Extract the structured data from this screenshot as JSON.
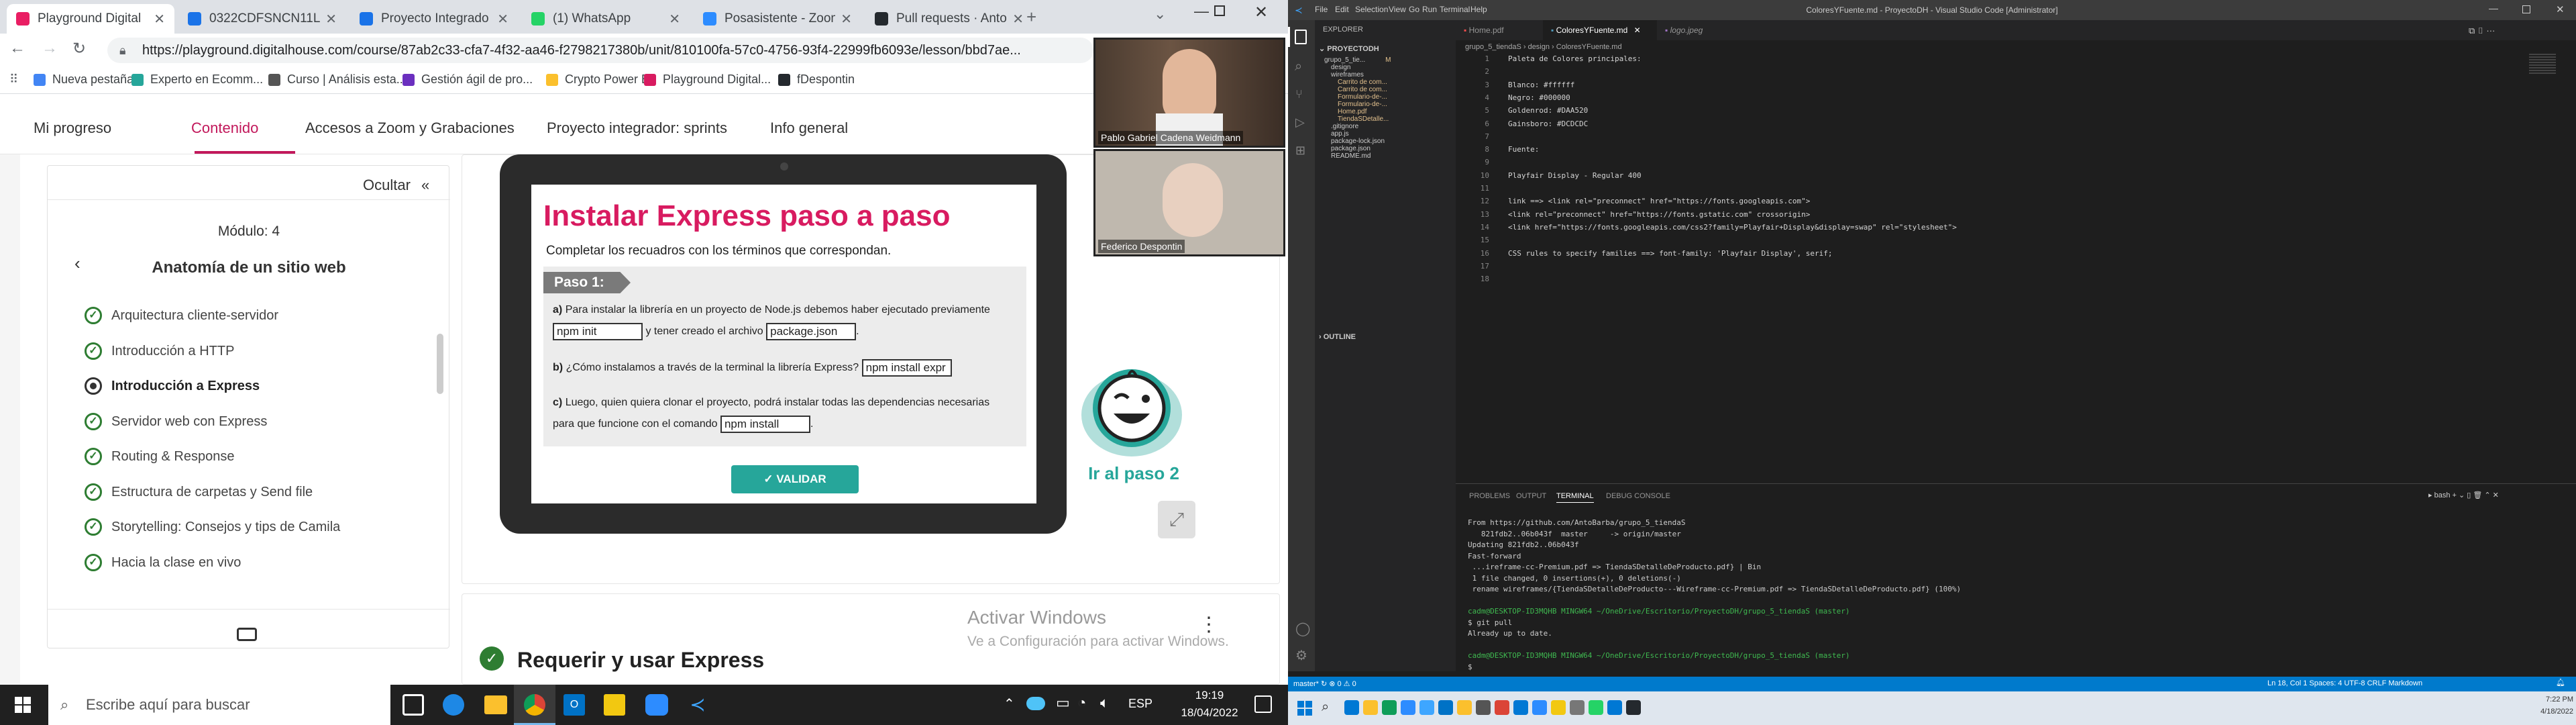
{
  "browser": {
    "tabs": [
      {
        "label": "Playground Digital",
        "color": "#e91e63",
        "active": true
      },
      {
        "label": "0322CDFSNCN11L",
        "color": "#1a73e8"
      },
      {
        "label": "Proyecto Integrado",
        "color": "#1a73e8"
      },
      {
        "label": "(1) WhatsApp",
        "color": "#25d366"
      },
      {
        "label": "Posasistente - Zoom",
        "color": "#2d8cff"
      },
      {
        "label": "Pull requests · Anto",
        "color": "#24292e"
      }
    ],
    "url": "https://playground.digitalhouse.com/course/87ab2c33-cfa7-4f32-aa46-f2798217380b/unit/810100fa-57c0-4756-93f4-22999fb6093e/lesson/bbd7ae...",
    "bookmarks": [
      "Nueva pestaña",
      "Experto en Ecomm...",
      "Curso | Análisis esta...",
      "Gestión ágil de pro...",
      "Crypto Power BI",
      "Playground Digital...",
      "fDespontin"
    ]
  },
  "nav": {
    "items": [
      "Mi progreso",
      "Contenido",
      "Accesos a Zoom y Grabaciones",
      "Proyecto integrador: sprints",
      "Info general"
    ]
  },
  "sidebar": {
    "hide_label": "Ocultar",
    "module": "Módulo: 4",
    "title": "Anatomía de un sitio web",
    "lessons": [
      "Arquitectura cliente-servidor",
      "Introducción a HTTP",
      "Introducción a Express",
      "Servidor web con Express",
      "Routing & Response",
      "Estructura de carpetas y Send file",
      "Storytelling: Consejos y tips de Camila",
      "Hacia la clase en vivo"
    ]
  },
  "slide": {
    "title": "Instalar Express paso a paso",
    "subtitle": "Completar los recuadros con los términos que correspondan.",
    "step": "Paso 1:",
    "qa_letter": "a)",
    "qa_text1": "Para instalar la librería en un proyecto de Node.js debemos haber ejecutado previamente",
    "qa_input1": "npm init",
    "qa_text2": "y tener creado el archivo",
    "qa_input2": "package.json",
    "qa_end": ".",
    "qb_letter": "b)",
    "qb_text": "¿Cómo instalamos a través de la terminal la librería Express?",
    "qb_input": "npm install expr",
    "qc_letter": "c)",
    "qc_text1": "Luego, quien quiera clonar el proyecto, podrá instalar todas las dependencias necesarias",
    "qc_text2": "para que funcione con el comando",
    "qc_input": "npm install",
    "qc_end": ".",
    "validate": "VALIDAR",
    "next_step": "Ir al paso 2"
  },
  "next_section": "Requerir y usar Express",
  "watermark": {
    "line1": "Activar Windows",
    "line2": "Ve a Configuración para activar Windows."
  },
  "zoom": {
    "p1": "Pablo Gabriel Cadena Weidmann",
    "p2": "Federico Despontin"
  },
  "taskbar": {
    "search": "Escribe aquí para buscar",
    "lang": "ESP",
    "time": "19:19",
    "date": "18/04/2022"
  },
  "vscode": {
    "title": "ColoresYFuente.md - ProyectoDH - Visual Studio Code [Administrator]",
    "menu": [
      "File",
      "Edit",
      "Selection",
      "View",
      "Go",
      "Run",
      "Terminal",
      "Help"
    ],
    "explorer_title": "EXPLORER",
    "project": "PROYECTODH",
    "tree": [
      {
        "t": "grupo_5_tie...",
        "d": 0,
        "c": "#ccc",
        "m": "M"
      },
      {
        "t": "design",
        "d": 1,
        "c": "#ccc"
      },
      {
        "t": "wireframes",
        "d": 1,
        "c": "#ccc"
      },
      {
        "t": "Carrito de com...",
        "d": 2,
        "c": "#e2c08d"
      },
      {
        "t": "Carrito de com...",
        "d": 2,
        "c": "#e2c08d"
      },
      {
        "t": "Formulario-de-...",
        "d": 2,
        "c": "#e2c08d"
      },
      {
        "t": "Formulario-de-...",
        "d": 2,
        "c": "#e2c08d"
      },
      {
        "t": "Home.pdf",
        "d": 2,
        "c": "#e2c08d"
      },
      {
        "t": "TiendaSDetalle...",
        "d": 2,
        "c": "#e2c08d"
      },
      {
        "t": ".gitignore",
        "d": 1,
        "c": "#ccc"
      },
      {
        "t": "app.js",
        "d": 1,
        "c": "#ccc"
      },
      {
        "t": "package-lock.json",
        "d": 1,
        "c": "#ccc"
      },
      {
        "t": "package.json",
        "d": 1,
        "c": "#ccc"
      },
      {
        "t": "README.md",
        "d": 1,
        "c": "#ccc"
      }
    ],
    "outline": "OUTLINE",
    "editor_tabs": [
      "Home.pdf",
      "ColoresYFuente.md",
      "logo.jpeg"
    ],
    "breadcrumb": "grupo_5_tiendaS  ›  design  ›  ColoresYFuente.md",
    "code": [
      "Paleta de Colores principales:",
      "",
      "Blanco: #ffffff",
      "Negro: #000000",
      "Goldenrod: #DAA520",
      "Gainsboro: #DCDCDC",
      "",
      "Fuente:",
      "",
      "Playfair Display - Regular 400",
      "",
      "link ==> <link rel=\"preconnect\" href=\"https://fonts.googleapis.com\">",
      "<link rel=\"preconnect\" href=\"https://fonts.gstatic.com\" crossorigin>",
      "<link href=\"https://fonts.googleapis.com/css2?family=Playfair+Display&display=swap\" rel=\"stylesheet\">",
      "",
      "CSS rules to specify families ==> font-family: 'Playfair Display', serif;",
      "",
      ""
    ],
    "panel_tabs": [
      "PROBLEMS",
      "OUTPUT",
      "TERMINAL",
      "DEBUG CONSOLE"
    ],
    "terminal_shell": "bash",
    "terminal": [
      "From https://github.com/AntoBarba/grupo_5_tiendaS",
      "   821fdb2..06b043f  master     -> origin/master",
      "Updating 821fdb2..06b043f",
      "Fast-forward",
      " ...ireframe-cc-Premium.pdf => TiendaSDetalleDeProducto.pdf} | Bin",
      " 1 file changed, 0 insertions(+), 0 deletions(-)",
      " rename wireframes/{TiendaSDetalleDeProducto---Wireframe-cc-Premium.pdf => TiendaSDetalleDeProducto.pdf} (100%)",
      "",
      "cadm@DESKTOP-ID3MQHB MINGW64 ~/OneDrive/Escritorio/ProyectoDH/grupo_5_tiendaS (master)",
      "$ git pull",
      "Already up to date.",
      "",
      "cadm@DESKTOP-ID3MQHB MINGW64 ~/OneDrive/Escritorio/ProyectoDH/grupo_5_tiendaS (master)",
      "$ "
    ],
    "status_left": "master* ↻  ⊗ 0 ⚠ 0",
    "status_right": "Ln 18, Col 1   Spaces: 4   UTF-8   CRLF   Markdown",
    "time": "7:22 PM",
    "date": "4/18/2022"
  }
}
